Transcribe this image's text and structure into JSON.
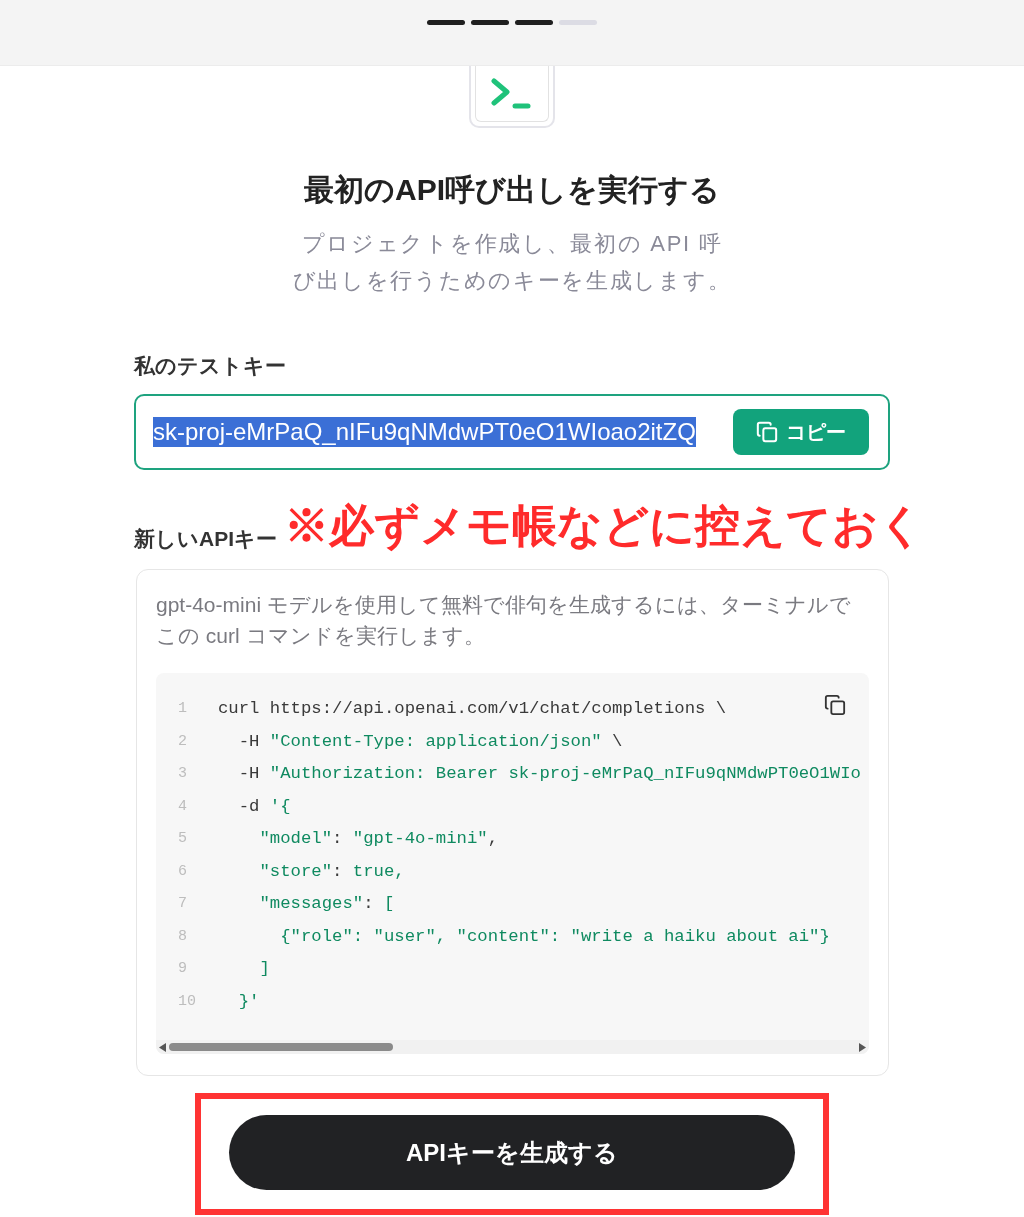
{
  "progress_steps": [
    {
      "completed": true
    },
    {
      "completed": true
    },
    {
      "completed": true
    },
    {
      "completed": false
    }
  ],
  "heading": "最初のAPI呼び出しを実行する",
  "subtitle": "プロジェクトを作成し、最初の API 呼び出しを行うためのキーを生成します。",
  "test_key": {
    "label": "私のテストキー",
    "value": "sk-proj-eMrPaQ_nIFu9qNMdwPT0eO1WIoao2itZQ",
    "selected": true,
    "copy_button": "コピー"
  },
  "annotation": "※必ずメモ帳などに控えておく",
  "new_key_section": {
    "label": "新しいAPIキー",
    "description": "gpt-4o-mini モデルを使用して無料で俳句を生成するには、ターミナルでこの curl コマンドを実行します。",
    "code_lines": [
      {
        "number": "1",
        "tokens": [
          {
            "kind": "plain",
            "text": "curl https://api.openai.com/v1/chat/completions \\"
          }
        ]
      },
      {
        "number": "2",
        "tokens": [
          {
            "kind": "plain",
            "text": "  -H "
          },
          {
            "kind": "string",
            "text": "\"Content-Type: application/json\""
          },
          {
            "kind": "plain",
            "text": " \\"
          }
        ]
      },
      {
        "number": "3",
        "tokens": [
          {
            "kind": "plain",
            "text": "  -H "
          },
          {
            "kind": "string",
            "text": "\"Authorization: Bearer sk-proj-eMrPaQ_nIFu9qNMdwPT0eO1WIo"
          }
        ]
      },
      {
        "number": "4",
        "tokens": [
          {
            "kind": "plain",
            "text": "  -d "
          },
          {
            "kind": "string",
            "text": "'{"
          }
        ]
      },
      {
        "number": "5",
        "tokens": [
          {
            "kind": "string",
            "text": "    \"model\""
          },
          {
            "kind": "plain",
            "text": ": "
          },
          {
            "kind": "string",
            "text": "\"gpt-4o-mini\""
          },
          {
            "kind": "plain",
            "text": ","
          }
        ]
      },
      {
        "number": "6",
        "tokens": [
          {
            "kind": "string",
            "text": "    \"store\""
          },
          {
            "kind": "plain",
            "text": ": "
          },
          {
            "kind": "string",
            "text": "true,"
          }
        ]
      },
      {
        "number": "7",
        "tokens": [
          {
            "kind": "string",
            "text": "    \"messages\""
          },
          {
            "kind": "plain",
            "text": ": "
          },
          {
            "kind": "string",
            "text": "["
          }
        ]
      },
      {
        "number": "8",
        "tokens": [
          {
            "kind": "string",
            "text": "      {\"role\": \"user\", \"content\": \"write a haiku about ai\"}"
          }
        ]
      },
      {
        "number": "9",
        "tokens": [
          {
            "kind": "string",
            "text": "    ]"
          }
        ]
      },
      {
        "number": "10",
        "tokens": [
          {
            "kind": "string",
            "text": "  }'"
          }
        ]
      }
    ]
  },
  "generate_button": "APIキーを生成する"
}
